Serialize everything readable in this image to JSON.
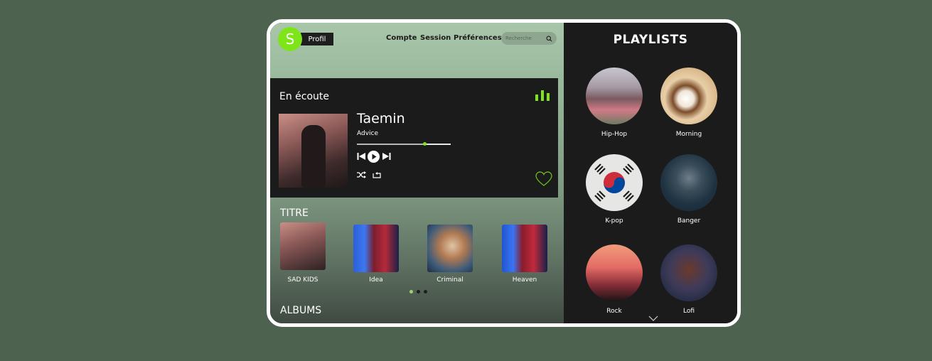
{
  "header": {
    "avatar_letter": "S",
    "profile_label": "Profil",
    "nav": [
      "Compte",
      "Session",
      "Préférences"
    ],
    "search_placeholder": "Recherche"
  },
  "now_playing": {
    "section_title": "En écoute",
    "artist": "Taemin",
    "song": "Advice",
    "progress": 0.72
  },
  "titles": {
    "section_title": "TITRE",
    "items": [
      {
        "name": "SAD KIDS"
      },
      {
        "name": "Idea"
      },
      {
        "name": "Criminal"
      },
      {
        "name": "Heaven"
      }
    ],
    "page_count": 3,
    "active_page": 0
  },
  "albums": {
    "section_title": "ALBUMS"
  },
  "playlists": {
    "title": "PLAYLISTS",
    "items": [
      {
        "name": "Hip-Hop"
      },
      {
        "name": "Morning"
      },
      {
        "name": "K-pop"
      },
      {
        "name": "Banger"
      },
      {
        "name": "Rock"
      },
      {
        "name": "Lofi"
      }
    ]
  },
  "colors": {
    "accent": "#7ee51a",
    "page_background": "#4e634f",
    "panel_dark": "#1b1b1b"
  }
}
